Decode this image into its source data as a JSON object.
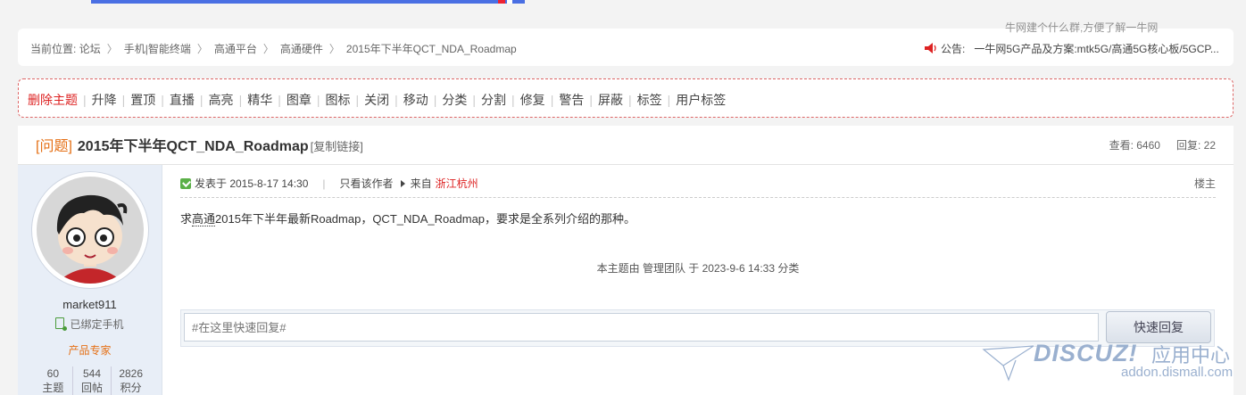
{
  "breadcrumb": {
    "prefix": "当前位置:",
    "items": [
      "论坛",
      "手机|智能终端",
      "高通平台",
      "高通硬件",
      "2015年下半年QCT_NDA_Roadmap"
    ]
  },
  "notice": {
    "label": "公告:",
    "text": "一牛网5G产品及方案:mtk5G/高通5G核心板/5GCP...",
    "ghost": "牛网建个什么群,方便了解一牛网"
  },
  "mod_actions": [
    "删除主题",
    "升降",
    "置顶",
    "直播",
    "高亮",
    "精华",
    "图章",
    "图标",
    "关闭",
    "移动",
    "分类",
    "分割",
    "修复",
    "警告",
    "屏蔽",
    "标签",
    "用户标签"
  ],
  "thread": {
    "type": "[问题]",
    "subject": "2015年下半年QCT_NDA_Roadmap",
    "copy_link": "[复制链接]",
    "views_label": "查看:",
    "views": "6460",
    "replies_label": "回复:",
    "replies": "22"
  },
  "author": {
    "username": "market911",
    "bind_status": "已绑定手机",
    "rank": "产品专家",
    "stats": [
      {
        "value": "60",
        "label": "主题"
      },
      {
        "value": "544",
        "label": "回帖"
      },
      {
        "value": "2826",
        "label": "积分"
      }
    ]
  },
  "post": {
    "posted_on": "发表于 2015-8-17 14:30",
    "only_author": "只看该作者",
    "from_label": "来自",
    "location": "浙江杭州",
    "floor": "楼主",
    "content_pre": "求",
    "content_kw": "高通",
    "content_post": "2015年下半年最新Roadmap，QCT_NDA_Roadmap，要求是全系列介绍的那种。",
    "classified": "本主题由 管理团队 于 2023-9-6 14:33 分类"
  },
  "quick_reply": {
    "placeholder": "#在这里快速回复#",
    "button": "快速回复"
  },
  "watermark": {
    "brand": "DISCUZ!",
    "sub": "应用中心",
    "url": "addon.dismall.com"
  },
  "colors": {
    "accent_orange": "#e57016",
    "danger_red": "#d22222",
    "watermark_blue": "#9ab0cf"
  }
}
